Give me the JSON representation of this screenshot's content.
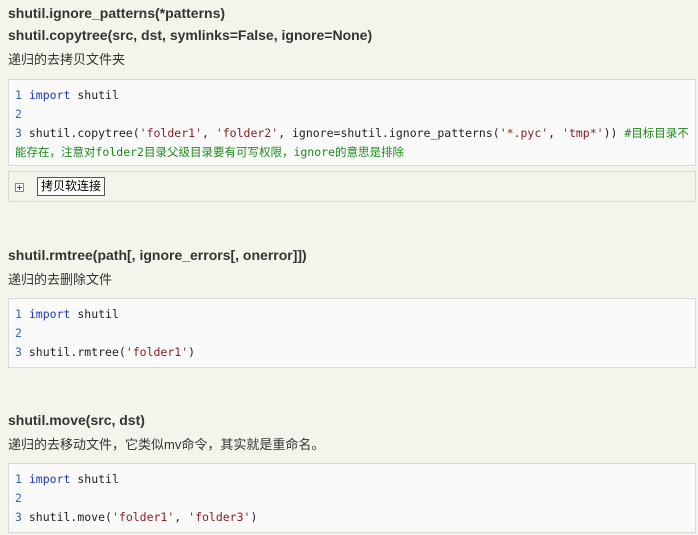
{
  "section1": {
    "heading1": "shutil.ignore_patterns(*patterns)",
    "heading2": "shutil.copytree(src, dst, symlinks=False, ignore=None)",
    "desc": "递归的去拷贝文件夹",
    "code": {
      "ln1": "1",
      "ln2": "2",
      "ln3": "3",
      "l1_kw": "import",
      "l1_rest": " shutil",
      "l3_a": "shutil.copytree(",
      "l3_s1": "'folder1'",
      "l3_b": ", ",
      "l3_s2": "'folder2'",
      "l3_c": ", ignore=shutil.ignore_patterns(",
      "l3_s3": "'*.pyc'",
      "l3_d": ", ",
      "l3_s4": "'tmp*'",
      "l3_e": ")) ",
      "l3_comment": "#目标目录不能存在，注意对folder2目录父级目录要有可写权限，ignore的意思是排除"
    },
    "expander_label": "拷贝软连接"
  },
  "section2": {
    "heading": "shutil.rmtree(path[, ignore_errors[, onerror]])",
    "desc": "递归的去删除文件",
    "code": {
      "ln1": "1",
      "ln2": "2",
      "ln3": "3",
      "l1_kw": "import",
      "l1_rest": " shutil",
      "l3_a": "shutil.rmtree(",
      "l3_s1": "'folder1'",
      "l3_b": ")"
    }
  },
  "section3": {
    "heading": "shutil.move(src, dst)",
    "desc": "递归的去移动文件，它类似mv命令，其实就是重命名。",
    "code": {
      "ln1": "1",
      "ln2": "2",
      "ln3": "3",
      "l1_kw": "import",
      "l1_rest": " shutil",
      "l3_a": "shutil.move(",
      "l3_s1": "'folder1'",
      "l3_b": ", ",
      "l3_s2": "'folder3'",
      "l3_c": ")"
    }
  },
  "colors": {
    "background": "#f5f4ec",
    "line_number": "#2b6ab8",
    "keyword": "#1a39c4",
    "string": "#8b1a1a",
    "comment": "#1d8a1d"
  },
  "icons": {
    "expander": "plus-box-icon"
  }
}
